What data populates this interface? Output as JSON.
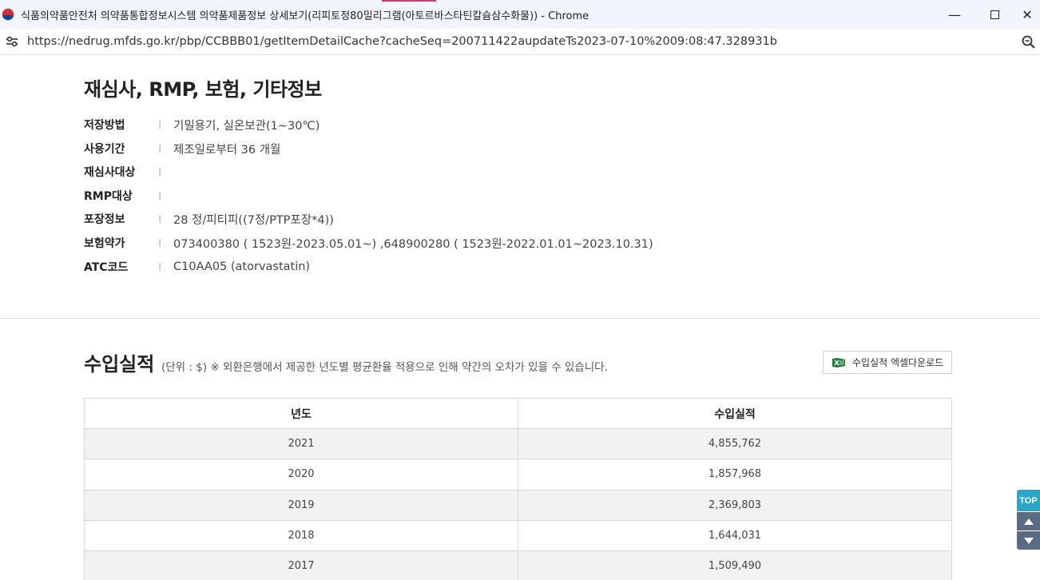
{
  "window": {
    "title": "식품의약품안전처 의약품통합정보시스템 의약품제품정보 상세보기(리피토정80밀리그램(아토르바스타틴칼슘삼수화물)) - Chrome",
    "minimize_glyph": "—",
    "close_glyph": "✕"
  },
  "address": {
    "url": "https://nedrug.mfds.go.kr/pbp/CCBBB01/getItemDetailCache?cacheSeq=200711422aupdateTs2023-07-10%2009:08:47.328931b"
  },
  "review_section": {
    "title": "재심사, RMP, 보험, 기타정보",
    "separator": "ㅣ",
    "rows": [
      {
        "label": "저장방법",
        "value": "기밀용기, 실온보관(1~30℃)"
      },
      {
        "label": "사용기간",
        "value": "제조일로부터 36 개월"
      },
      {
        "label": "재심사대상",
        "value": ""
      },
      {
        "label": "RMP대상",
        "value": ""
      },
      {
        "label": "포장정보",
        "value": "28 정/피티피((7정/PTP포장*4))"
      },
      {
        "label": "보험약가",
        "value": "073400380 ( 1523원-2023.05.01~) ,648900280 ( 1523원-2022.01.01~2023.10.31)"
      },
      {
        "label": "ATC코드",
        "value": "C10AA05 (atorvastatin)"
      }
    ]
  },
  "import_section": {
    "title": "수입실적",
    "note": "(단위 : $) ※ 외환은행에서 제공한 년도별 평균환율 적용으로 인해 약간의 오차가 있을 수 있습니다.",
    "excel_button": "수입실적 엑셀다운로드",
    "columns": [
      "년도",
      "수입실적"
    ],
    "rows": [
      {
        "year": "2021",
        "amount": "4,855,762"
      },
      {
        "year": "2020",
        "amount": "1,857,968"
      },
      {
        "year": "2019",
        "amount": "2,369,803"
      },
      {
        "year": "2018",
        "amount": "1,644,031"
      },
      {
        "year": "2017",
        "amount": "1,509,490"
      }
    ]
  },
  "floating": {
    "top_label": "TOP"
  },
  "colors": {
    "titlebar_bg": "#f2f5fc",
    "top_button": "#2aa6c6",
    "arrow_buttons": "#5a6b86",
    "table_stripe": "#f2f2f2",
    "excel_green": "#1e7b3a"
  }
}
